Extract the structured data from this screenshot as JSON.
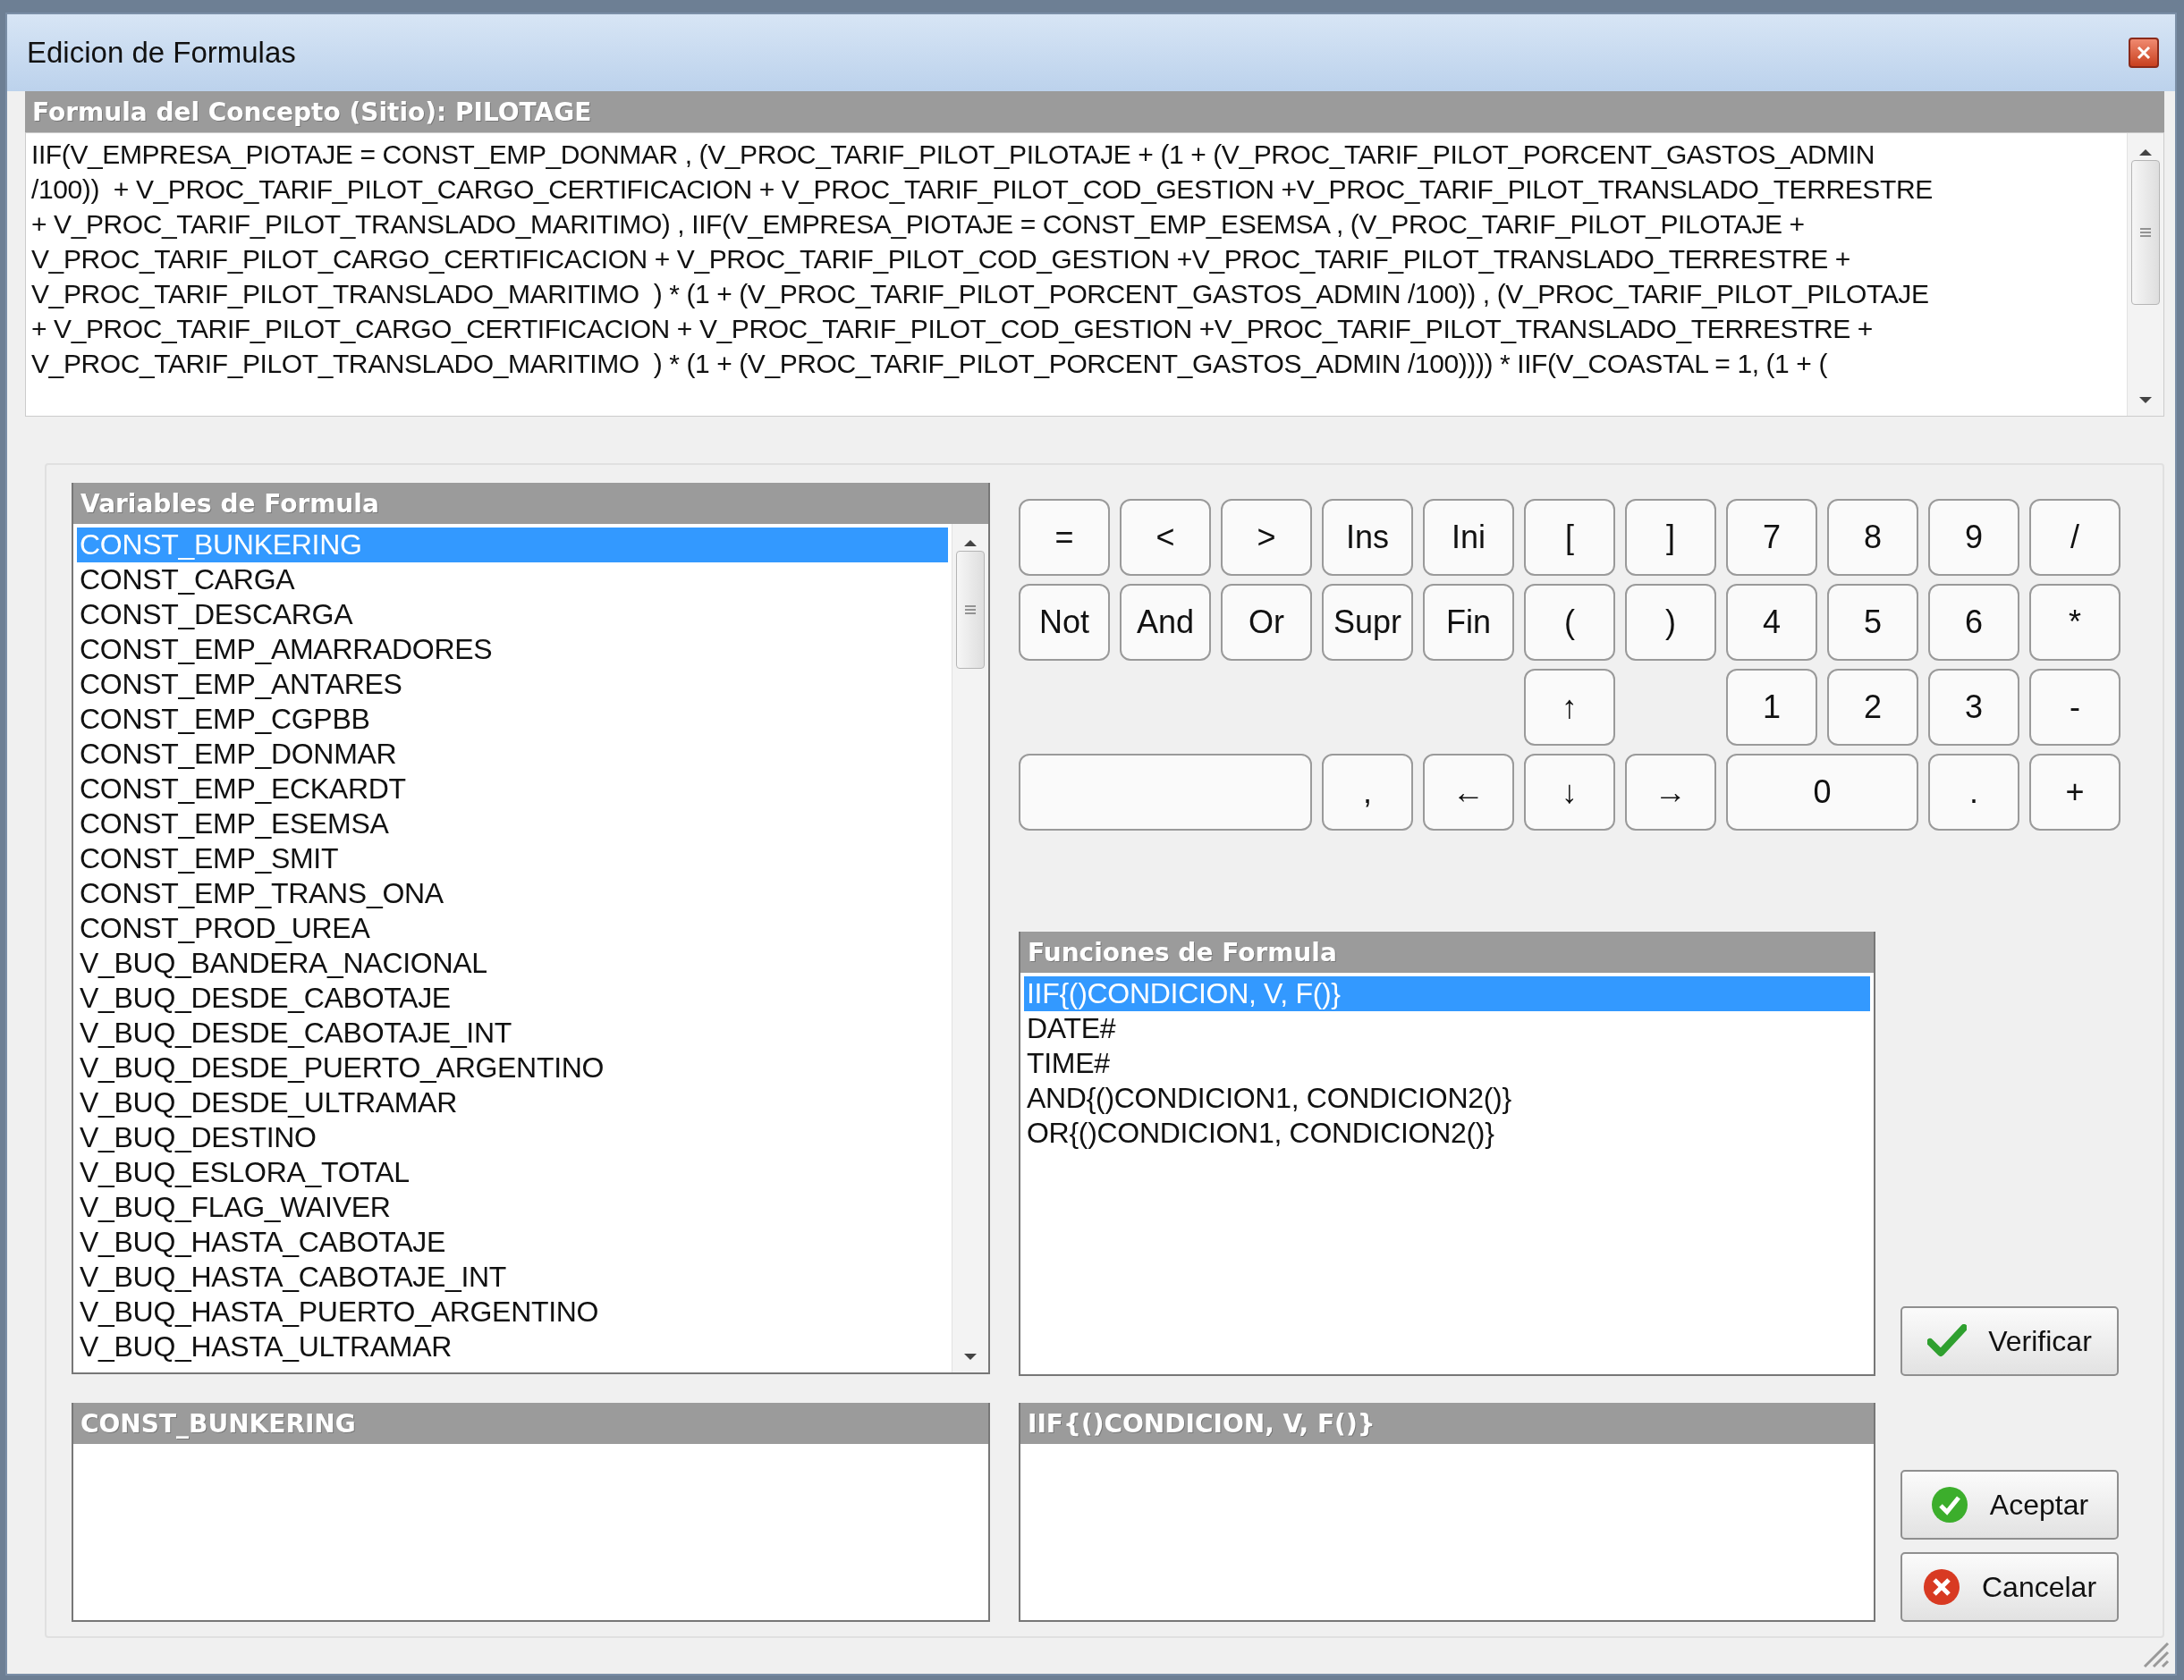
{
  "window": {
    "title": "Edicion de Formulas"
  },
  "formula": {
    "header": "Formula del Concepto (Sitio): PILOTAGE",
    "lines": [
      "IIF(V_EMPRESA_PIOTAJE = CONST_EMP_DONMAR , (V_PROC_TARIF_PILOT_PILOTAJE + (1 + (V_PROC_TARIF_PILOT_PORCENT_GASTOS_ADMIN",
      "/100))  + V_PROC_TARIF_PILOT_CARGO_CERTIFICACION + V_PROC_TARIF_PILOT_COD_GESTION +V_PROC_TARIF_PILOT_TRANSLADO_TERRESTRE",
      "+ V_PROC_TARIF_PILOT_TRANSLADO_MARITIMO) , IIF(V_EMPRESA_PIOTAJE = CONST_EMP_ESEMSA , (V_PROC_TARIF_PILOT_PILOTAJE +",
      "V_PROC_TARIF_PILOT_CARGO_CERTIFICACION + V_PROC_TARIF_PILOT_COD_GESTION +V_PROC_TARIF_PILOT_TRANSLADO_TERRESTRE +",
      "V_PROC_TARIF_PILOT_TRANSLADO_MARITIMO  ) * (1 + (V_PROC_TARIF_PILOT_PORCENT_GASTOS_ADMIN /100)) , (V_PROC_TARIF_PILOT_PILOTAJE",
      "+ V_PROC_TARIF_PILOT_CARGO_CERTIFICACION + V_PROC_TARIF_PILOT_COD_GESTION +V_PROC_TARIF_PILOT_TRANSLADO_TERRESTRE +",
      "V_PROC_TARIF_PILOT_TRANSLADO_MARITIMO  ) * (1 + (V_PROC_TARIF_PILOT_PORCENT_GASTOS_ADMIN /100)))) * IIF(V_COASTAL = 1, (1 + ("
    ]
  },
  "variables": {
    "header": "Variables de Formula",
    "items": [
      {
        "label": "CONST_BUNKERING",
        "selected": true
      },
      {
        "label": "CONST_CARGA",
        "selected": false
      },
      {
        "label": "CONST_DESCARGA",
        "selected": false
      },
      {
        "label": "CONST_EMP_AMARRADORES",
        "selected": false
      },
      {
        "label": "CONST_EMP_ANTARES",
        "selected": false
      },
      {
        "label": "CONST_EMP_CGPBB",
        "selected": false
      },
      {
        "label": "CONST_EMP_DONMAR",
        "selected": false
      },
      {
        "label": "CONST_EMP_ECKARDT",
        "selected": false
      },
      {
        "label": "CONST_EMP_ESEMSA",
        "selected": false
      },
      {
        "label": "CONST_EMP_SMIT",
        "selected": false
      },
      {
        "label": "CONST_EMP_TRANS_ONA",
        "selected": false
      },
      {
        "label": "CONST_PROD_UREA",
        "selected": false
      },
      {
        "label": "V_BUQ_BANDERA_NACIONAL",
        "selected": false
      },
      {
        "label": "V_BUQ_DESDE_CABOTAJE",
        "selected": false
      },
      {
        "label": "V_BUQ_DESDE_CABOTAJE_INT",
        "selected": false
      },
      {
        "label": "V_BUQ_DESDE_PUERTO_ARGENTINO",
        "selected": false
      },
      {
        "label": "V_BUQ_DESDE_ULTRAMAR",
        "selected": false
      },
      {
        "label": "V_BUQ_DESTINO",
        "selected": false
      },
      {
        "label": "V_BUQ_ESLORA_TOTAL",
        "selected": false
      },
      {
        "label": "V_BUQ_FLAG_WAIVER",
        "selected": false
      },
      {
        "label": "V_BUQ_HASTA_CABOTAJE",
        "selected": false
      },
      {
        "label": "V_BUQ_HASTA_CABOTAJE_INT",
        "selected": false
      },
      {
        "label": "V_BUQ_HASTA_PUERTO_ARGENTINO",
        "selected": false
      },
      {
        "label": "V_BUQ_HASTA_ULTRAMAR",
        "selected": false
      }
    ]
  },
  "keypad": {
    "rows": [
      [
        "=",
        "<",
        ">",
        "Ins",
        "Ini",
        "[",
        "]",
        "7",
        "8",
        "9",
        "/"
      ],
      [
        "Not",
        "And",
        "Or",
        "Supr",
        "Fin",
        "(",
        ")",
        "4",
        "5",
        "6",
        "*"
      ],
      [
        "",
        "",
        "",
        "",
        "",
        "↑",
        "",
        "1",
        "2",
        "3",
        "-"
      ],
      [
        "",
        "",
        "",
        ",",
        "←",
        "↓",
        "→",
        "0",
        "",
        ".",
        "+"
      ]
    ]
  },
  "functions": {
    "header": "Funciones de Formula",
    "items": [
      {
        "label": "IIF{()CONDICION, V, F()}",
        "selected": true
      },
      {
        "label": "DATE#",
        "selected": false
      },
      {
        "label": "TIME#",
        "selected": false
      },
      {
        "label": "AND{()CONDICION1, CONDICION2()}",
        "selected": false
      },
      {
        "label": "OR{()CONDICION1, CONDICION2()}",
        "selected": false
      }
    ]
  },
  "verify_button": "Verificar",
  "variable_detail": {
    "header": "CONST_BUNKERING"
  },
  "function_detail": {
    "header": "IIF{()CONDICION, V, F()}"
  },
  "accept_button": "Aceptar",
  "cancel_button": "Cancelar"
}
